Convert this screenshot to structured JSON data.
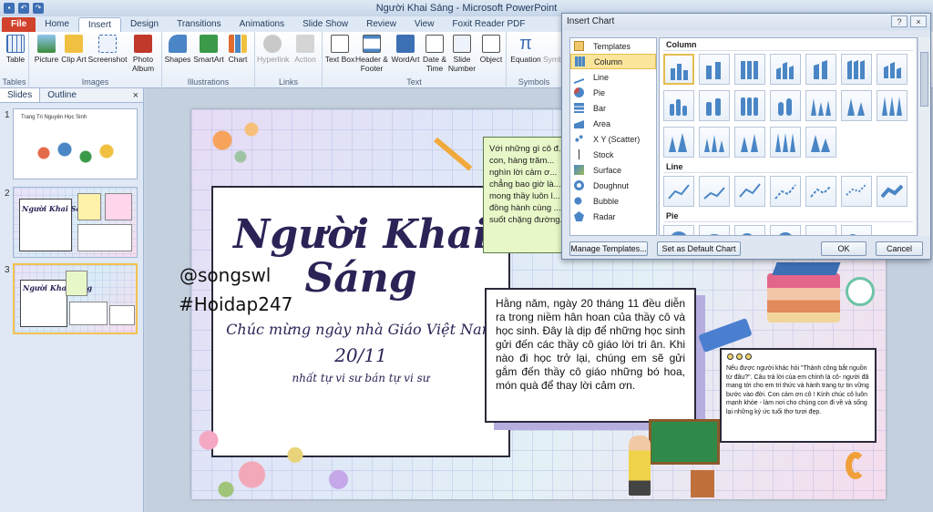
{
  "window": {
    "title": "Người Khai Sáng - Microsoft PowerPoint"
  },
  "ribbon_tabs": [
    {
      "label": "File"
    },
    {
      "label": "Home"
    },
    {
      "label": "Insert"
    },
    {
      "label": "Design"
    },
    {
      "label": "Transitions"
    },
    {
      "label": "Animations"
    },
    {
      "label": "Slide Show"
    },
    {
      "label": "Review"
    },
    {
      "label": "View"
    },
    {
      "label": "Foxit Reader PDF"
    }
  ],
  "ribbon": {
    "groups": {
      "tables": "Tables",
      "images": "Images",
      "illustrations": "Illustrations",
      "links": "Links",
      "text": "Text",
      "symbols": "Symbols"
    },
    "buttons": {
      "table": "Table",
      "picture": "Picture",
      "clip_art": "Clip Art",
      "screenshot": "Screenshot",
      "photo_album": "Photo Album",
      "shapes": "Shapes",
      "smartart": "SmartArt",
      "chart": "Chart",
      "hyperlink": "Hyperlink",
      "action": "Action",
      "text_box": "Text Box",
      "header_footer": "Header & Footer",
      "wordart": "WordArt",
      "date_time": "Date & Time",
      "slide_number": "Slide Number",
      "object": "Object",
      "equation": "Equation",
      "symbol": "Symb"
    }
  },
  "left_pane": {
    "tab_slides": "Slides",
    "tab_outline": "Outline",
    "close": "×",
    "thumbnails": [
      {
        "number": "1",
        "title": "Trang Tri Nguyên Học Sinh"
      },
      {
        "number": "2",
        "title": "Người Khai Sáng"
      },
      {
        "number": "3",
        "title": "Người Khai Sáng"
      }
    ]
  },
  "slide": {
    "title": "Người Khai Sáng",
    "subtitle": "Chúc mừng ngày nhà Giáo Việt Nam",
    "date": "20/11",
    "tagline": "nhất tự vi sư bán tự vi sư",
    "note_top": "Với những gì cô đ... con, hàng trăm... nghìn lời cảm ơ... chẳng bao giờ là... mong thầy luôn l... đồng hành cùng ... suốt chặng đường...",
    "center_text": "Hằng năm, ngày 20 tháng 11 đều diễn ra trong niềm hân hoan của thầy cô và học sinh. Đây là dịp để những học sinh gửi đến các thầy cô giáo lời tri ân. Khi nào đi học trở lại, chúng em sẽ gửi gắm đến thầy cô giáo những bó hoa, món quà để thay lời cảm ơn.",
    "right_text": "Nếu được người khác hỏi \"Thành công bắt nguồn từ đâu?\". Câu trả lời của em chính là cô- người đã mang tới cho em tri thức và hành trang tự tin vững bước vào đời. Con cảm ơn cô ! Kính chúc cô luôn mạnh khỏe - làm nơi cho chúng con đi về và sống lại những ký ức tuổi thơ tươi đẹp."
  },
  "watermark": {
    "line1": "@songswl",
    "line2": "#Hoidap247"
  },
  "dialog": {
    "title": "Insert Chart",
    "help": "?",
    "close": "×",
    "types": [
      {
        "label": "Templates",
        "icon": "folder-icon"
      },
      {
        "label": "Column",
        "icon": "column-chart-icon"
      },
      {
        "label": "Line",
        "icon": "line-chart-icon"
      },
      {
        "label": "Pie",
        "icon": "pie-chart-icon"
      },
      {
        "label": "Bar",
        "icon": "bar-chart-icon"
      },
      {
        "label": "Area",
        "icon": "area-chart-icon"
      },
      {
        "label": "X Y (Scatter)",
        "icon": "scatter-chart-icon"
      },
      {
        "label": "Stock",
        "icon": "stock-chart-icon"
      },
      {
        "label": "Surface",
        "icon": "surface-chart-icon"
      },
      {
        "label": "Doughnut",
        "icon": "doughnut-chart-icon"
      },
      {
        "label": "Bubble",
        "icon": "bubble-chart-icon"
      },
      {
        "label": "Radar",
        "icon": "radar-chart-icon"
      }
    ],
    "selected_type": "Column",
    "section_column": "Column",
    "section_line": "Line",
    "section_pie": "Pie",
    "manage_templates": "Manage Templates...",
    "set_default": "Set as Default Chart",
    "ok": "OK",
    "cancel": "Cancel"
  },
  "colors": {
    "accent": "#2b5797",
    "file_tab": "#d1422c",
    "selection": "#fbe59b",
    "title_ink": "#2b2356"
  }
}
